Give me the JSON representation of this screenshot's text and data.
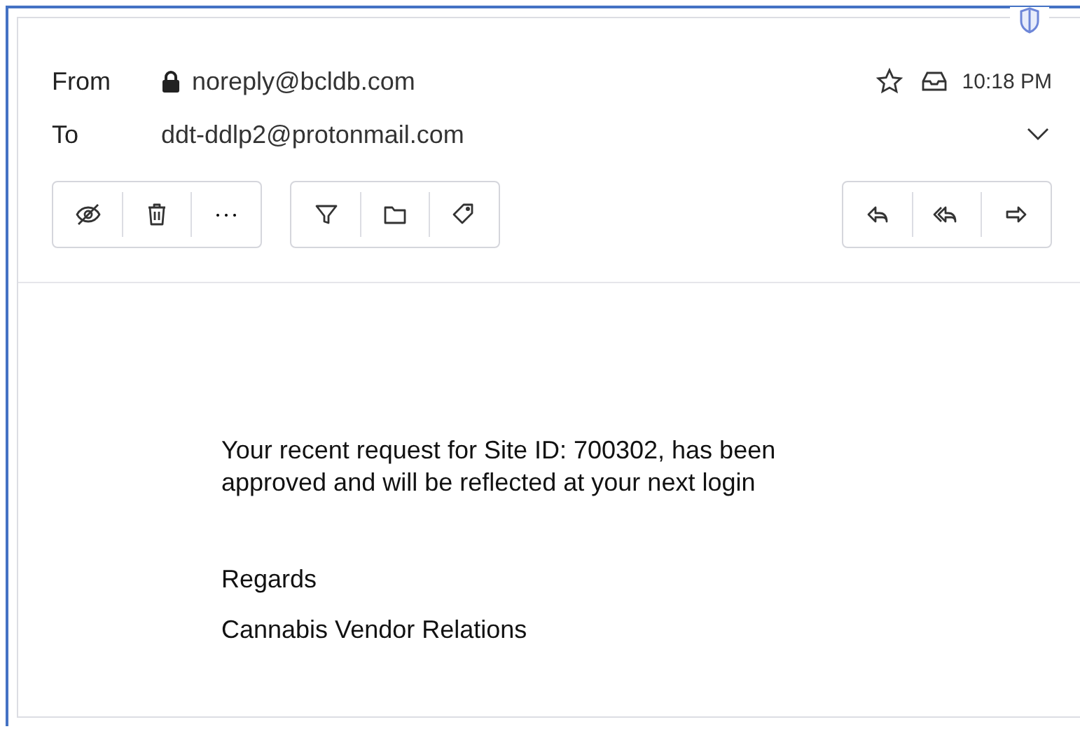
{
  "header": {
    "from_label": "From",
    "from_address": "noreply@bcldb.com",
    "to_label": "To",
    "to_address": "ddt-ddlp2@protonmail.com",
    "time": "10:18 PM",
    "starred": false
  },
  "toolbar_groups": [
    {
      "buttons": [
        {
          "kind": "hide"
        },
        {
          "kind": "trash"
        },
        {
          "kind": "more"
        }
      ]
    },
    {
      "buttons": [
        {
          "kind": "filter"
        },
        {
          "kind": "folder"
        },
        {
          "kind": "label"
        }
      ]
    },
    {
      "buttons": [
        {
          "kind": "reply"
        },
        {
          "kind": "reply-all"
        },
        {
          "kind": "forward"
        }
      ]
    }
  ],
  "body": {
    "paragraphs": [
      "Your recent request for Site ID: 700302, has been approved and will be reflected at your next login",
      "Regards",
      "Cannabis Vendor Relations"
    ]
  }
}
